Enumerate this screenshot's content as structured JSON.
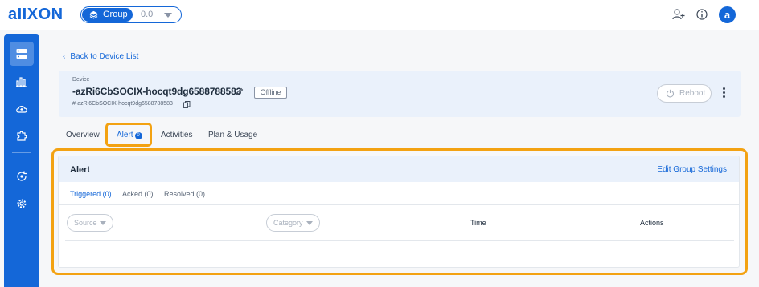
{
  "app": {
    "logo": "aIIXON",
    "group_label": "Group",
    "group_value": "0.0",
    "avatar_initial": "a",
    "accent_color": "#1467d8",
    "highlight_color": "#f3a212"
  },
  "header_icons": [
    "add-user-icon",
    "info-icon"
  ],
  "sidebar": {
    "items": [
      {
        "icon": "server-icon",
        "active": true
      },
      {
        "icon": "bar-chart-icon",
        "active": false
      },
      {
        "icon": "cloud-upload-icon",
        "active": false
      },
      {
        "icon": "puzzle-icon",
        "active": false
      },
      {
        "icon": "refresh-gear-icon",
        "active": false
      },
      {
        "icon": "settings-icon",
        "active": false
      }
    ]
  },
  "breadcrumb": {
    "back_label": "Back to Device List"
  },
  "device": {
    "section_label": "Device",
    "name": "-azRi6CbSOCIX-hocqt9dg6588788583",
    "status": "Offline",
    "id": "#-azRi6CbSOCIX-hocqt9dg6588788583",
    "reboot_label": "Reboot"
  },
  "tabs": [
    {
      "label": "Overview"
    },
    {
      "label": "Alert",
      "count": "0",
      "active": true
    },
    {
      "label": "Activities"
    },
    {
      "label": "Plan & Usage"
    }
  ],
  "alert": {
    "title": "Alert",
    "edit_link": "Edit Group Settings",
    "subtabs": [
      "Triggered (0)",
      "Acked (0)",
      "Resolved (0)"
    ],
    "columns": {
      "source": "Source",
      "category": "Category",
      "time": "Time",
      "actions": "Actions"
    }
  }
}
